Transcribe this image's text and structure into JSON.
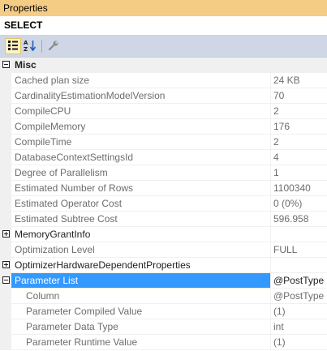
{
  "window": {
    "title": "Properties"
  },
  "object_selector": {
    "name": "SELECT"
  },
  "toolbar": {
    "categorized_icon": "categorized-icon",
    "alphabetical_icon": "alphabetical-icon",
    "property_pages_icon": "wrench-icon"
  },
  "grid": {
    "misc": {
      "label": "Misc",
      "rows": [
        {
          "name": "Cached plan size",
          "value": "24 KB"
        },
        {
          "name": "CardinalityEstimationModelVersion",
          "value": "70"
        },
        {
          "name": "CompileCPU",
          "value": "2"
        },
        {
          "name": "CompileMemory",
          "value": "176"
        },
        {
          "name": "CompileTime",
          "value": "2"
        },
        {
          "name": "DatabaseContextSettingsId",
          "value": "4"
        },
        {
          "name": "Degree of Parallelism",
          "value": "1"
        },
        {
          "name": "Estimated Number of Rows",
          "value": "1100340"
        },
        {
          "name": "Estimated Operator Cost",
          "value": "0 (0%)"
        },
        {
          "name": "Estimated Subtree Cost",
          "value": "596.958"
        }
      ]
    },
    "memory_grant": {
      "name": "MemoryGrantInfo",
      "value": ""
    },
    "optimization_level": {
      "name": "Optimization Level",
      "value": "FULL"
    },
    "optimizer_hw": {
      "name": "OptimizerHardwareDependentProperties",
      "value": ""
    },
    "parameter_list": {
      "name": "Parameter List",
      "value": "@PostType",
      "children": [
        {
          "name": "Column",
          "value": "@PostType"
        },
        {
          "name": "Parameter Compiled Value",
          "value": "(1)"
        },
        {
          "name": "Parameter Data Type",
          "value": "int"
        },
        {
          "name": "Parameter Runtime Value",
          "value": "(1)"
        }
      ]
    }
  },
  "colors": {
    "title_bar": "#f5cc84",
    "toolbar": "#cfd6e5",
    "selection": "#3399ff",
    "gutter": "#f0f0f0",
    "inherited_text": "#6d6d6d"
  }
}
